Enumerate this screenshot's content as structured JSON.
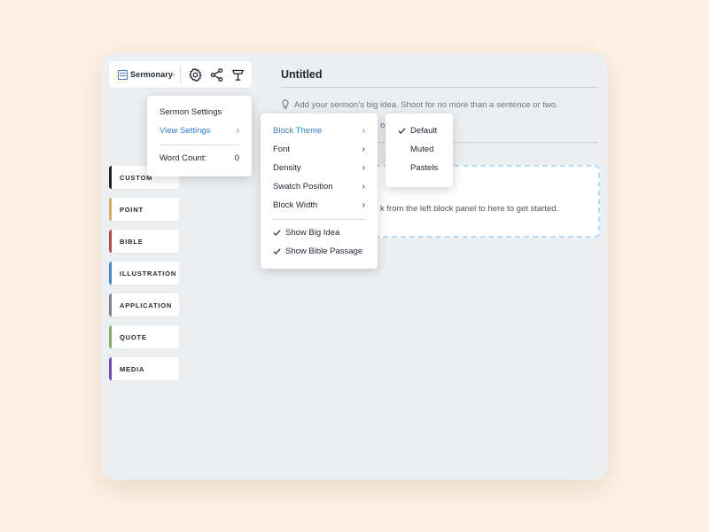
{
  "app": {
    "name": "Sermonary",
    "mark": "®"
  },
  "toolbar": {
    "settings_icon": "gear-icon",
    "share_icon": "share-icon",
    "pulpit_icon": "podium-icon"
  },
  "document": {
    "title": "Untitled",
    "big_idea_placeholder": "Add your sermon’s big idea. Shoot for no more than a sentence or two.",
    "passage_fragment": "ol",
    "drop_text": "k from the left block panel to here to get started."
  },
  "blocks": [
    {
      "label": "CUSTOM",
      "color": "#1f1f1f"
    },
    {
      "label": "POINT",
      "color": "#f0a045"
    },
    {
      "label": "BIBLE",
      "color": "#d93a2b"
    },
    {
      "label": "ILLUSTRATION",
      "color": "#2f8fe0"
    },
    {
      "label": "APPLICATION",
      "color": "#7b8089"
    },
    {
      "label": "QUOTE",
      "color": "#6cbf3a"
    },
    {
      "label": "MEDIA",
      "color": "#7a3fe0"
    }
  ],
  "settings_menu": {
    "sermon_settings": "Sermon Settings",
    "view_settings": "View Settings",
    "word_count_label": "Word Count:",
    "word_count_value": "0"
  },
  "view_menu": {
    "block_theme": "Block Theme",
    "font": "Font",
    "density": "Density",
    "swatch_position": "Swatch Position",
    "block_width": "Block Width",
    "show_big_idea": "Show Big Idea",
    "show_bible_passage": "Show Bible Passage"
  },
  "theme_menu": {
    "default": "Default",
    "muted": "Muted",
    "pastels": "Pastels",
    "selected": "Default"
  },
  "colors": {
    "accent": "#2f7fd6",
    "background": "#fdf1e3",
    "app_bg": "#eceff2"
  }
}
